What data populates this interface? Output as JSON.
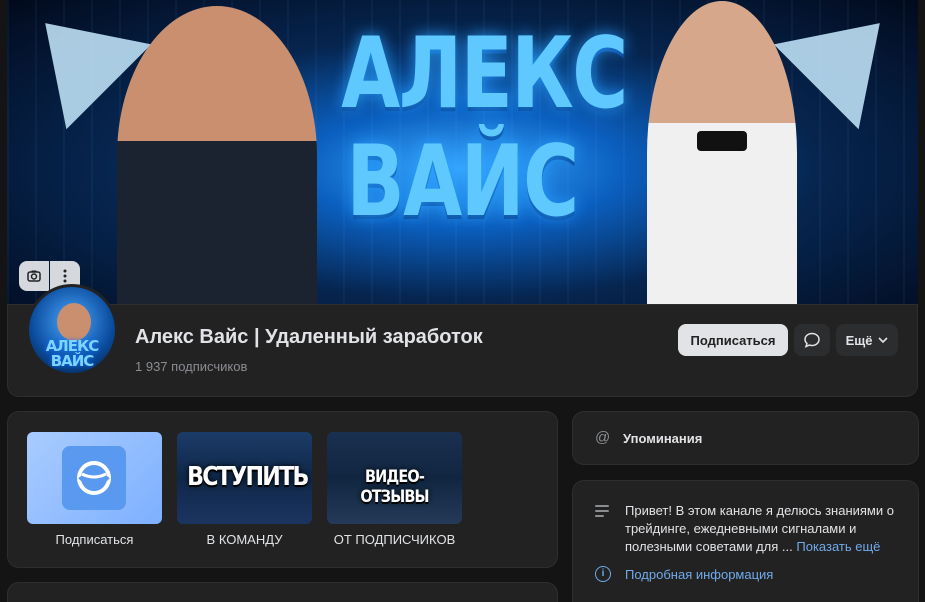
{
  "cover": {
    "title": "АЛЕКС ВАЙС",
    "title_line1": "АЛЕКС",
    "title_line2": "ВАЙС",
    "camera_icon": "camera-icon",
    "more_icon": "vertical-dots-icon"
  },
  "channel": {
    "avatar_text": "АЛЕКС ВАЙС",
    "name": "Алекс Вайс | Удаленный заработок",
    "subscribers_count": "1 937",
    "subscribers_label": "подписчиков",
    "subscribe_label": "Подписаться",
    "message_icon": "chat-bubble-icon",
    "more_label": "Ещё",
    "more_icon": "chevron-down-icon"
  },
  "links": [
    {
      "label": "Подписаться",
      "image_text": "",
      "icon": "messenger-logo-icon"
    },
    {
      "label": "В КОМАНДУ",
      "image_text": "ВСТУПИТЬ"
    },
    {
      "label": "ОТ ПОДПИСЧИКОВ",
      "image_text": "ВИДЕО-ОТЗЫВЫ"
    }
  ],
  "mentions": {
    "label": "Упоминания",
    "icon": "at-sign-icon"
  },
  "about": {
    "description": "Привет! В этом канале я делюсь знаниями о трейдинге, ежедневными сигналами и полезными советами для ...",
    "show_more": "Показать ещё",
    "details_link": "Подробная информация",
    "info_icon": "info-icon"
  }
}
